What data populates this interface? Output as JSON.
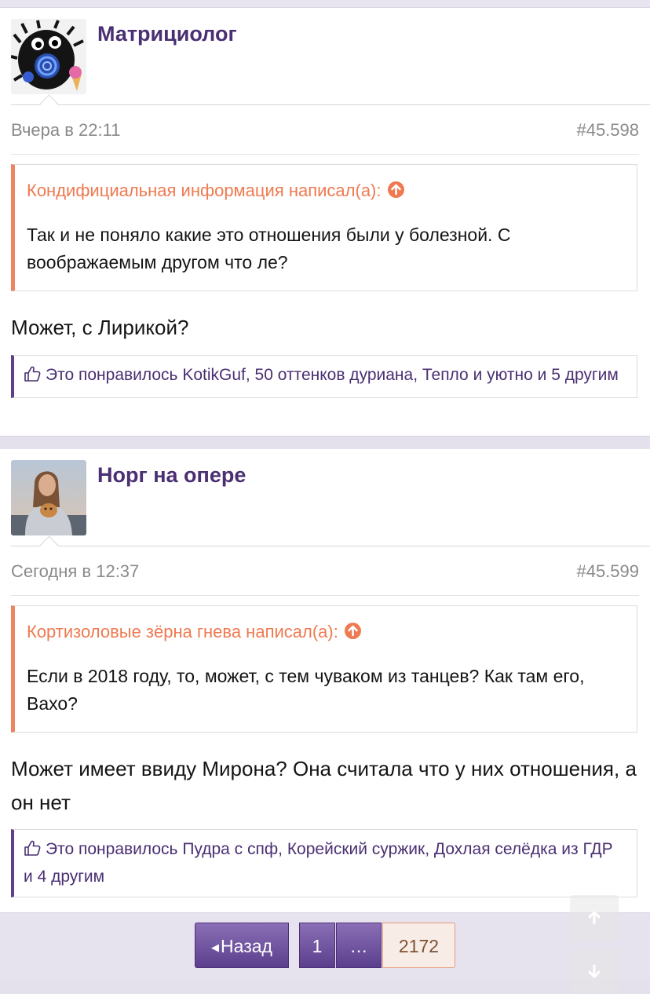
{
  "posts": [
    {
      "username": "Матрициолог",
      "date": "Вчера в 22:11",
      "number": "#45.598",
      "quote": {
        "author": "Кондифициальная информация написал(а):",
        "text": "Так и не поняло какие это отношения были у болезной. С воображаемым другом что ле?"
      },
      "message": "Может, с Лирикой?",
      "likes": "Это понравилось KotikGuf, 50 оттенков дуриана, Тепло и уютно и 5 другим"
    },
    {
      "username": "Норг на опере",
      "date": "Сегодня в 12:37",
      "number": "#45.599",
      "quote": {
        "author": "Кортизоловые зёрна гнева написал(а):",
        "text": "Если в 2018 году, то, может, с тем чуваком из танцев? Как там его, Вахо?"
      },
      "message": "Может имеет ввиду Мирона? Она считала что у них отношения, а он нет",
      "likes": "Это понравилось Пудра с спф, Корейский суржик, Дохлая селёдка из ГДР и 4 другим"
    }
  ],
  "pagination": {
    "back_label": "Назад",
    "pages": [
      "1",
      "…",
      "2172"
    ],
    "current": "2172"
  },
  "icons": {
    "quote_jump": "arrow-up-circle-icon",
    "like": "thumbs-up-icon",
    "back": "triangle-left-icon",
    "scroll_up": "arrow-up-icon",
    "scroll_down": "arrow-down-icon"
  },
  "colors": {
    "username": "#4a2f72",
    "quote_accent": "#ef7a51",
    "likes_accent": "#5d3f8c",
    "page_button": "#6d50a0",
    "current_page_bg": "#f8ece6"
  }
}
